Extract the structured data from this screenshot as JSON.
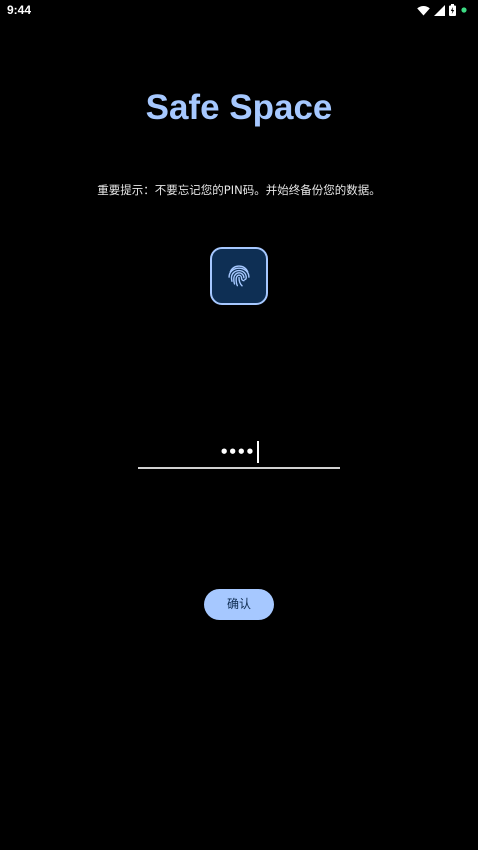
{
  "status_bar": {
    "time": "9:44",
    "icons": [
      "wifi-icon",
      "cell-signal-icon",
      "battery-icon",
      "notification-dot-icon"
    ],
    "dot_color": "#3ddc84"
  },
  "app": {
    "title": "Safe Space",
    "warning": "重要提示：不要忘记您的PIN码。并始终备份您的数据。",
    "fingerprint_icon": "fingerprint-icon"
  },
  "pin_input": {
    "value": "••••"
  },
  "actions": {
    "confirm_label": "确认"
  },
  "colors": {
    "background": "#000000",
    "accent": "#a6c8ff",
    "fingerprint_bg": "#0e2f54",
    "button_text": "#0d2b50"
  }
}
